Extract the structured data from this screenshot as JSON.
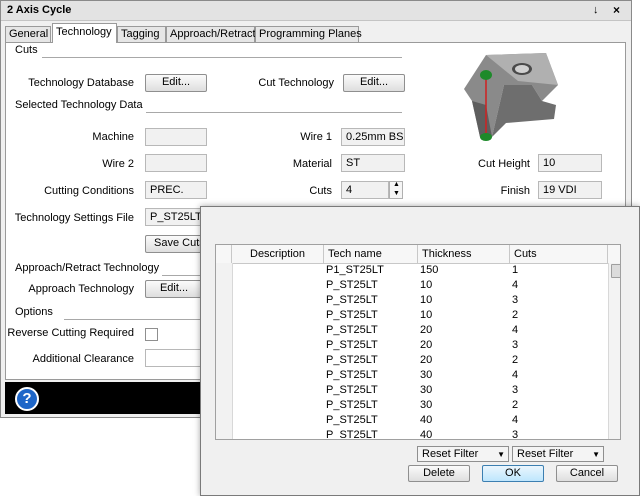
{
  "window": {
    "title": "2 Axis Cycle",
    "pin_glyph": "↓",
    "close_glyph": "×"
  },
  "tabs": [
    "General",
    "Technology",
    "Tagging",
    "Approach/Retract",
    "Programming Planes"
  ],
  "cuts_section": {
    "title": "Cuts",
    "tech_db_label": "Technology Database",
    "tech_db_button": "Edit...",
    "cut_tech_label": "Cut Technology",
    "cut_tech_button": "Edit..."
  },
  "selected_section": {
    "title": "Selected Technology Data",
    "machine_label": "Machine",
    "machine_value": "",
    "wire1_label": "Wire 1",
    "wire1_value": "0.25mm BS",
    "wire2_label": "Wire 2",
    "wire2_value": "",
    "material_label": "Material",
    "material_value": "ST",
    "cutting_label": "Cutting Conditions",
    "cutting_value": "PREC.",
    "cuts_label": "Cuts",
    "cuts_value": "4",
    "settings_label": "Technology Settings File",
    "settings_value": "P_ST25LT",
    "save_button": "Save Cuts",
    "cut_height_label": "Cut Height",
    "cut_height_value": "10",
    "finish_label": "Finish",
    "finish_value": "19 VDI"
  },
  "approach_section": {
    "title": "Approach/Retract Technology",
    "approach_label": "Approach Technology",
    "approach_button": "Edit..."
  },
  "options_section": {
    "title": "Options",
    "reverse_label": "Reverse Cutting Required",
    "reverse_checked": false,
    "clearance_label": "Additional Clearance",
    "clearance_value": ""
  },
  "help_icon": "?",
  "popup": {
    "columns": [
      "Description",
      "Tech name",
      "Thickness",
      "Cuts"
    ],
    "rows": [
      {
        "tech": "P1_ST25LT",
        "thickness": "150",
        "cuts": "1"
      },
      {
        "tech": "P_ST25LT",
        "thickness": "10",
        "cuts": "4"
      },
      {
        "tech": "P_ST25LT",
        "thickness": "10",
        "cuts": "3"
      },
      {
        "tech": "P_ST25LT",
        "thickness": "10",
        "cuts": "2"
      },
      {
        "tech": "P_ST25LT",
        "thickness": "20",
        "cuts": "4"
      },
      {
        "tech": "P_ST25LT",
        "thickness": "20",
        "cuts": "3"
      },
      {
        "tech": "P_ST25LT",
        "thickness": "20",
        "cuts": "2"
      },
      {
        "tech": "P_ST25LT",
        "thickness": "30",
        "cuts": "4"
      },
      {
        "tech": "P_ST25LT",
        "thickness": "30",
        "cuts": "3"
      },
      {
        "tech": "P_ST25LT",
        "thickness": "30",
        "cuts": "2"
      },
      {
        "tech": "P_ST25LT",
        "thickness": "40",
        "cuts": "4"
      },
      {
        "tech": "P_ST25LT",
        "thickness": "40",
        "cuts": "3"
      }
    ],
    "filter1": "Reset Filter",
    "filter2": "Reset Filter",
    "delete_button": "Delete",
    "ok_button": "OK",
    "cancel_button": "Cancel"
  }
}
